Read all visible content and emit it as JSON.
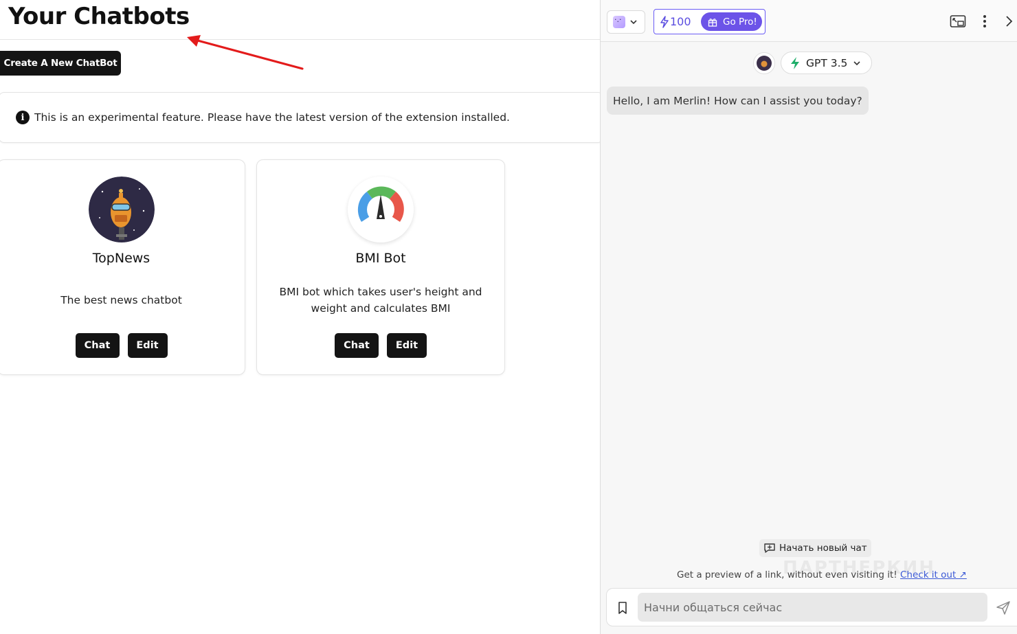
{
  "page": {
    "title": "Your Chatbots",
    "create_button": "Create A New ChatBot"
  },
  "notice": {
    "icon": "info-icon",
    "bold_text": "This is an experimental feature.",
    "text": "Please have the latest version of the extension installed."
  },
  "chatbots": [
    {
      "name": "TopNews",
      "description": "The best news chatbot",
      "avatar": "robot-news-avatar",
      "chat_label": "Chat",
      "edit_label": "Edit"
    },
    {
      "name": "BMI Bot",
      "description": "BMI bot which takes user's height and weight and calculates BMI",
      "avatar": "gauge-avatar",
      "chat_label": "Chat",
      "edit_label": "Edit"
    }
  ],
  "panel": {
    "credits": "100",
    "go_pro": "Go Pro!",
    "model": "GPT 3.5",
    "greeting": "Hello, I am Merlin! How can I assist you today?",
    "new_chat": "Начать новый чат",
    "preview_text": "Get a preview of a link, without even visiting it!",
    "preview_link": "Check it out ↗",
    "input_placeholder": "Начни общаться сейчас",
    "watermark": "ПАРТНЕРКИН"
  },
  "colors": {
    "accent": "#6c53e8",
    "dark_button": "#141414",
    "arrow": "#e31b1b",
    "gpt_bolt": "#1fae6a"
  }
}
